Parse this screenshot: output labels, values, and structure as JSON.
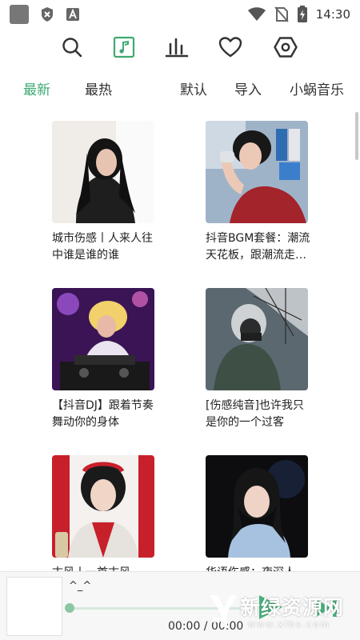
{
  "status_bar": {
    "time": "14:30",
    "left_icons": [
      "app-square-icon",
      "shield-x-icon",
      "keyboard-a-icon"
    ],
    "right_icons": [
      "wifi-icon",
      "no-sim-icon",
      "battery-charging-icon"
    ]
  },
  "toolbar": {
    "icons": [
      "search-icon",
      "music-note-icon",
      "bar-chart-icon",
      "heart-icon",
      "settings-hexagon-icon"
    ],
    "active": "music-note-icon",
    "accent_color": "#3daa72"
  },
  "tabs": {
    "items": [
      {
        "label": "最新",
        "active": true
      },
      {
        "label": "最热",
        "active": false
      },
      {
        "label": "默认",
        "active": false
      },
      {
        "label": "导入",
        "active": false
      },
      {
        "label": "小蜗音乐",
        "active": false
      }
    ]
  },
  "playlists": [
    {
      "title": "城市伤感丨人来人往中谁是谁的谁"
    },
    {
      "title": "抖音BGM套餐：潮流天花板，跟潮流走…"
    },
    {
      "title": "【抖音DJ】跟着节奏舞动你的身体"
    },
    {
      "title": "[伤感纯音]也许我只是你的一个过客"
    },
    {
      "title": "古风丨一首古风"
    },
    {
      "title": "华语伤感：夜深人"
    }
  ],
  "player": {
    "title": "^_^",
    "time": "00:00 / 00:00",
    "progress": 0
  },
  "watermark": {
    "text": "新绿资源网",
    "url": "www.xlhs.com"
  }
}
